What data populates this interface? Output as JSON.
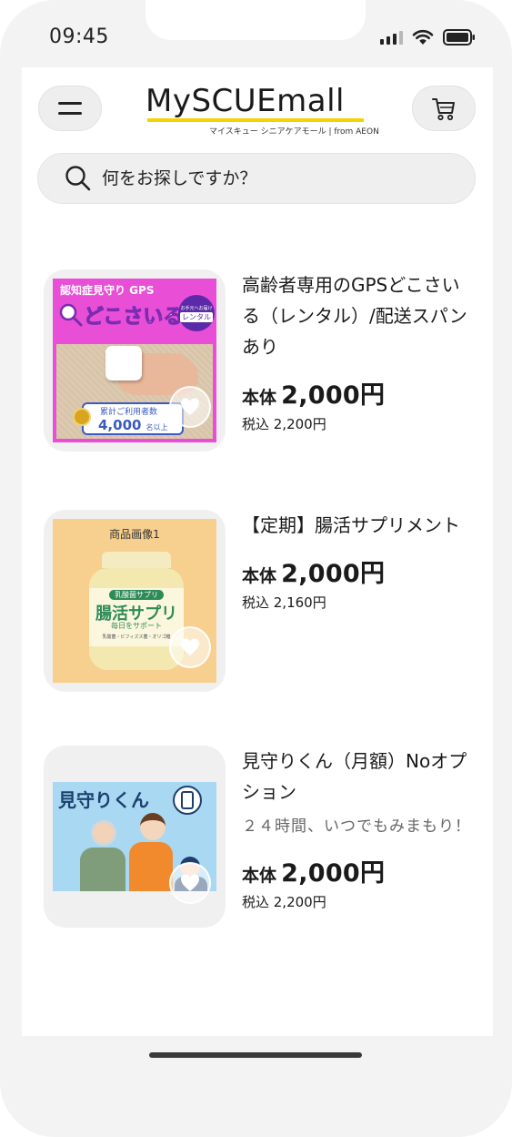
{
  "status_bar": {
    "time": "09:45"
  },
  "header": {
    "logo_text": "MySCUEmall",
    "logo_subtitle": "マイスキュー シニアケアモール | from AEON"
  },
  "search": {
    "placeholder": "何をお探しですか？"
  },
  "products": [
    {
      "name": "高齢者専用のGPSどこさいる（レンタル）/配送スパンあり",
      "description": "",
      "price_label": "本体",
      "price": "2,000円",
      "tax_included": "税込 2,200円",
      "image": {
        "banner": "認知症見守り GPS",
        "title": "どこさいる",
        "rental_badge_top": "お手元へお届け",
        "rental_badge": "レンタル",
        "stat_line1": "累計ご利用者数",
        "stat_line2": "4,000",
        "stat_suffix": "名以上"
      }
    },
    {
      "name": "【定期】腸活サプリメント",
      "description": "",
      "price_label": "本体",
      "price": "2,000円",
      "tax_included": "税込 2,160円",
      "image": {
        "caption": "商品画像1",
        "label_top": "乳酸菌サプリ",
        "label_main": "腸活サプリ",
        "label_sub": "毎日をサポート",
        "label_small": "乳酸菌・ビフィズス菌・オリゴ糖"
      }
    },
    {
      "name": "見守りくん（月額）Noオプション",
      "description": "２４時間、いつでもみまもり！",
      "price_label": "本体",
      "price": "2,000円",
      "tax_included": "税込 2,200円",
      "image": {
        "title": "見守りくん"
      }
    }
  ],
  "colors": {
    "accent_yellow": "#f5d200",
    "gps_pink": "#e84fd6",
    "supplement_bg": "#f7cf8e",
    "mimamori_bg": "#a9d8f2"
  }
}
